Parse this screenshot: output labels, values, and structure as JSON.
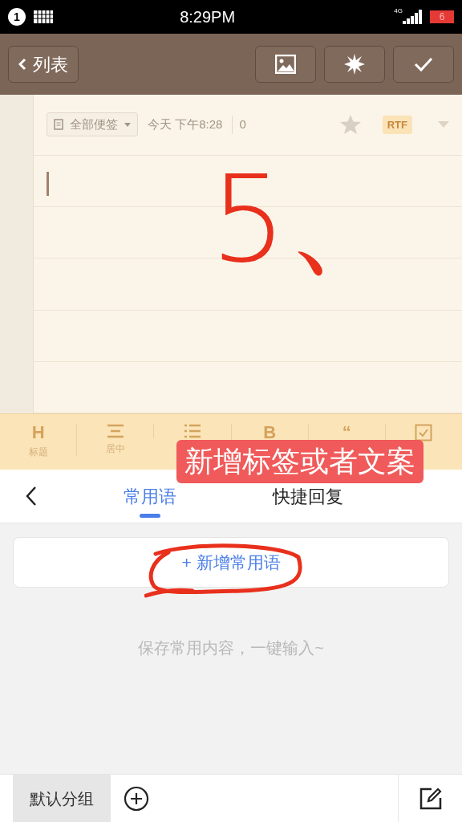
{
  "status_bar": {
    "notification_count": "1",
    "time": "8:29PM",
    "network": "4G",
    "battery": "6"
  },
  "toolbar": {
    "back_label": "列表",
    "buttons": [
      {
        "kind": "image"
      },
      {
        "kind": "sparkle"
      },
      {
        "kind": "check"
      }
    ]
  },
  "note": {
    "category": "全部便签",
    "time": "今天 下午8:28",
    "count": "0",
    "starred": false,
    "format_badge": "RTF",
    "handwriting": "5、"
  },
  "format_bar": [
    {
      "kind": "heading",
      "icon": "H",
      "label": "标题"
    },
    {
      "kind": "center",
      "label": "居中"
    },
    {
      "kind": "list"
    },
    {
      "kind": "bold",
      "icon": "B"
    },
    {
      "kind": "quote",
      "icon": "“"
    },
    {
      "kind": "checkbox"
    }
  ],
  "annotation_label": "新增标签或者文案",
  "sheet": {
    "tabs": [
      {
        "label": "常用语",
        "selected": true
      },
      {
        "label": "快捷回复",
        "selected": false
      }
    ],
    "add_button": "+ 新增常用语",
    "empty_hint": "保存常用内容，一键输入~",
    "groups": [
      {
        "label": "默认分组",
        "selected": true
      }
    ]
  }
}
